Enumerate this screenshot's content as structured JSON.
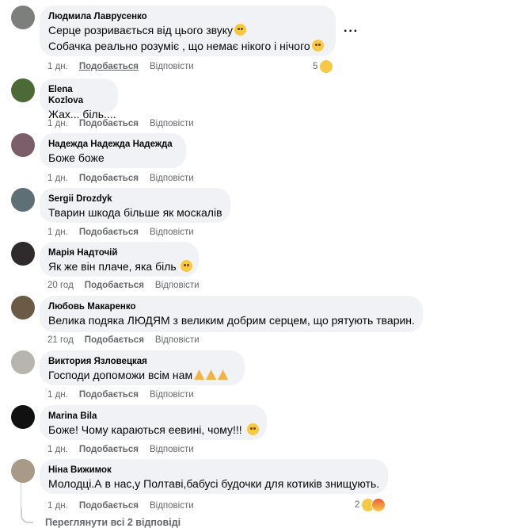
{
  "comments": [
    {
      "author": "Людмила Лаврусенко",
      "lines": [
        "Серце розривається від цього звуку",
        "Собачка реально розуміє , що немає нікого і нічого"
      ],
      "time": "1 дн.",
      "like": "Подобається",
      "reply": "Відповісти",
      "reaction_count": "5",
      "avatar_color": "#7d7f7c"
    },
    {
      "author": "Elena Kozlova",
      "lines": [
        "Жах... біль...."
      ],
      "time": "1 дн.",
      "like": "Подобається",
      "reply": "Відповісти",
      "avatar_color": "#4c6a36"
    },
    {
      "author": "Надежда Надежда Надежда",
      "lines": [
        "Боже боже"
      ],
      "time": "1 дн.",
      "like": "Подобається",
      "reply": "Відповісти",
      "avatar_color": "#7b5e6a"
    },
    {
      "author": "Sergii Drozdyk",
      "lines": [
        "Тварин шкода більше як москалів"
      ],
      "time": "1 дн.",
      "like": "Подобається",
      "reply": "Відповісти",
      "avatar_color": "#5f6f76"
    },
    {
      "author": "Марія Надточій",
      "lines": [
        "Як же він плаче, яка біль"
      ],
      "time": "20 год",
      "like": "Подобається",
      "reply": "Відповісти",
      "avatar_color": "#2f2a2c"
    },
    {
      "author": "Любовь Макаренко",
      "lines": [
        "Велика подяка ЛЮДЯМ з великим добрим серцем, що рятують тварин."
      ],
      "time": "21 год",
      "like": "Подобається",
      "reply": "Відповісти",
      "avatar_color": "#6b5a45"
    },
    {
      "author": "Виктория Язловецкая",
      "lines": [
        "Господи допоможи всім нам"
      ],
      "time": "1 дн.",
      "like": "Подобається",
      "reply": "Відповісти",
      "avatar_color": "#b8b4ae"
    },
    {
      "author": "Marina Bila",
      "lines": [
        "Боже! Чому караються еевині, чому!!!"
      ],
      "time": "1 дн.",
      "like": "Подобається",
      "reply": "Відповісти",
      "avatar_color": "#111111"
    },
    {
      "author": "Ніна Вижимок",
      "lines": [
        "Молодці.А в нас,у Полтаві,бабусі будочки для котиків знищують."
      ],
      "time": "1 дн.",
      "like": "Подобається",
      "reply": "Відповісти",
      "reaction_count": "2",
      "avatar_color": "#a89a86"
    }
  ],
  "see_replies": "Переглянути всі 2 відповіді",
  "more_label": "···"
}
